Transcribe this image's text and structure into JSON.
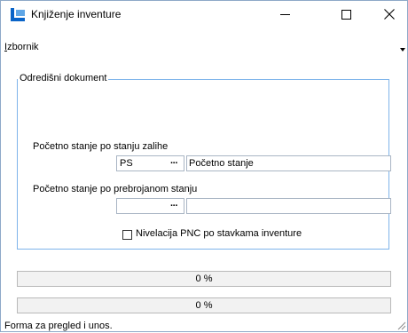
{
  "window": {
    "title": "Knjiženje inventure",
    "accent_color": "#0a64c8",
    "icon": "app-logo-icon"
  },
  "menu": {
    "items": [
      {
        "hotkey": "I",
        "rest": "zbornik"
      }
    ]
  },
  "group": {
    "label": "Odredišni dokument",
    "fields": [
      {
        "label": "Početno stanje po stanju zalihe",
        "code": "PS",
        "browse": "···",
        "name": "Početno stanje"
      },
      {
        "label": "Početno stanje po prebrojanom stanju",
        "code": "",
        "browse": "···",
        "name": ""
      }
    ],
    "checkbox": {
      "label": "Nivelacija PNC po stavkama inventure",
      "checked": false
    }
  },
  "progress": [
    {
      "text": "0 %",
      "value": 0
    },
    {
      "text": "0 %",
      "value": 0
    }
  ],
  "status": {
    "text": "Forma za pregled i unos."
  }
}
